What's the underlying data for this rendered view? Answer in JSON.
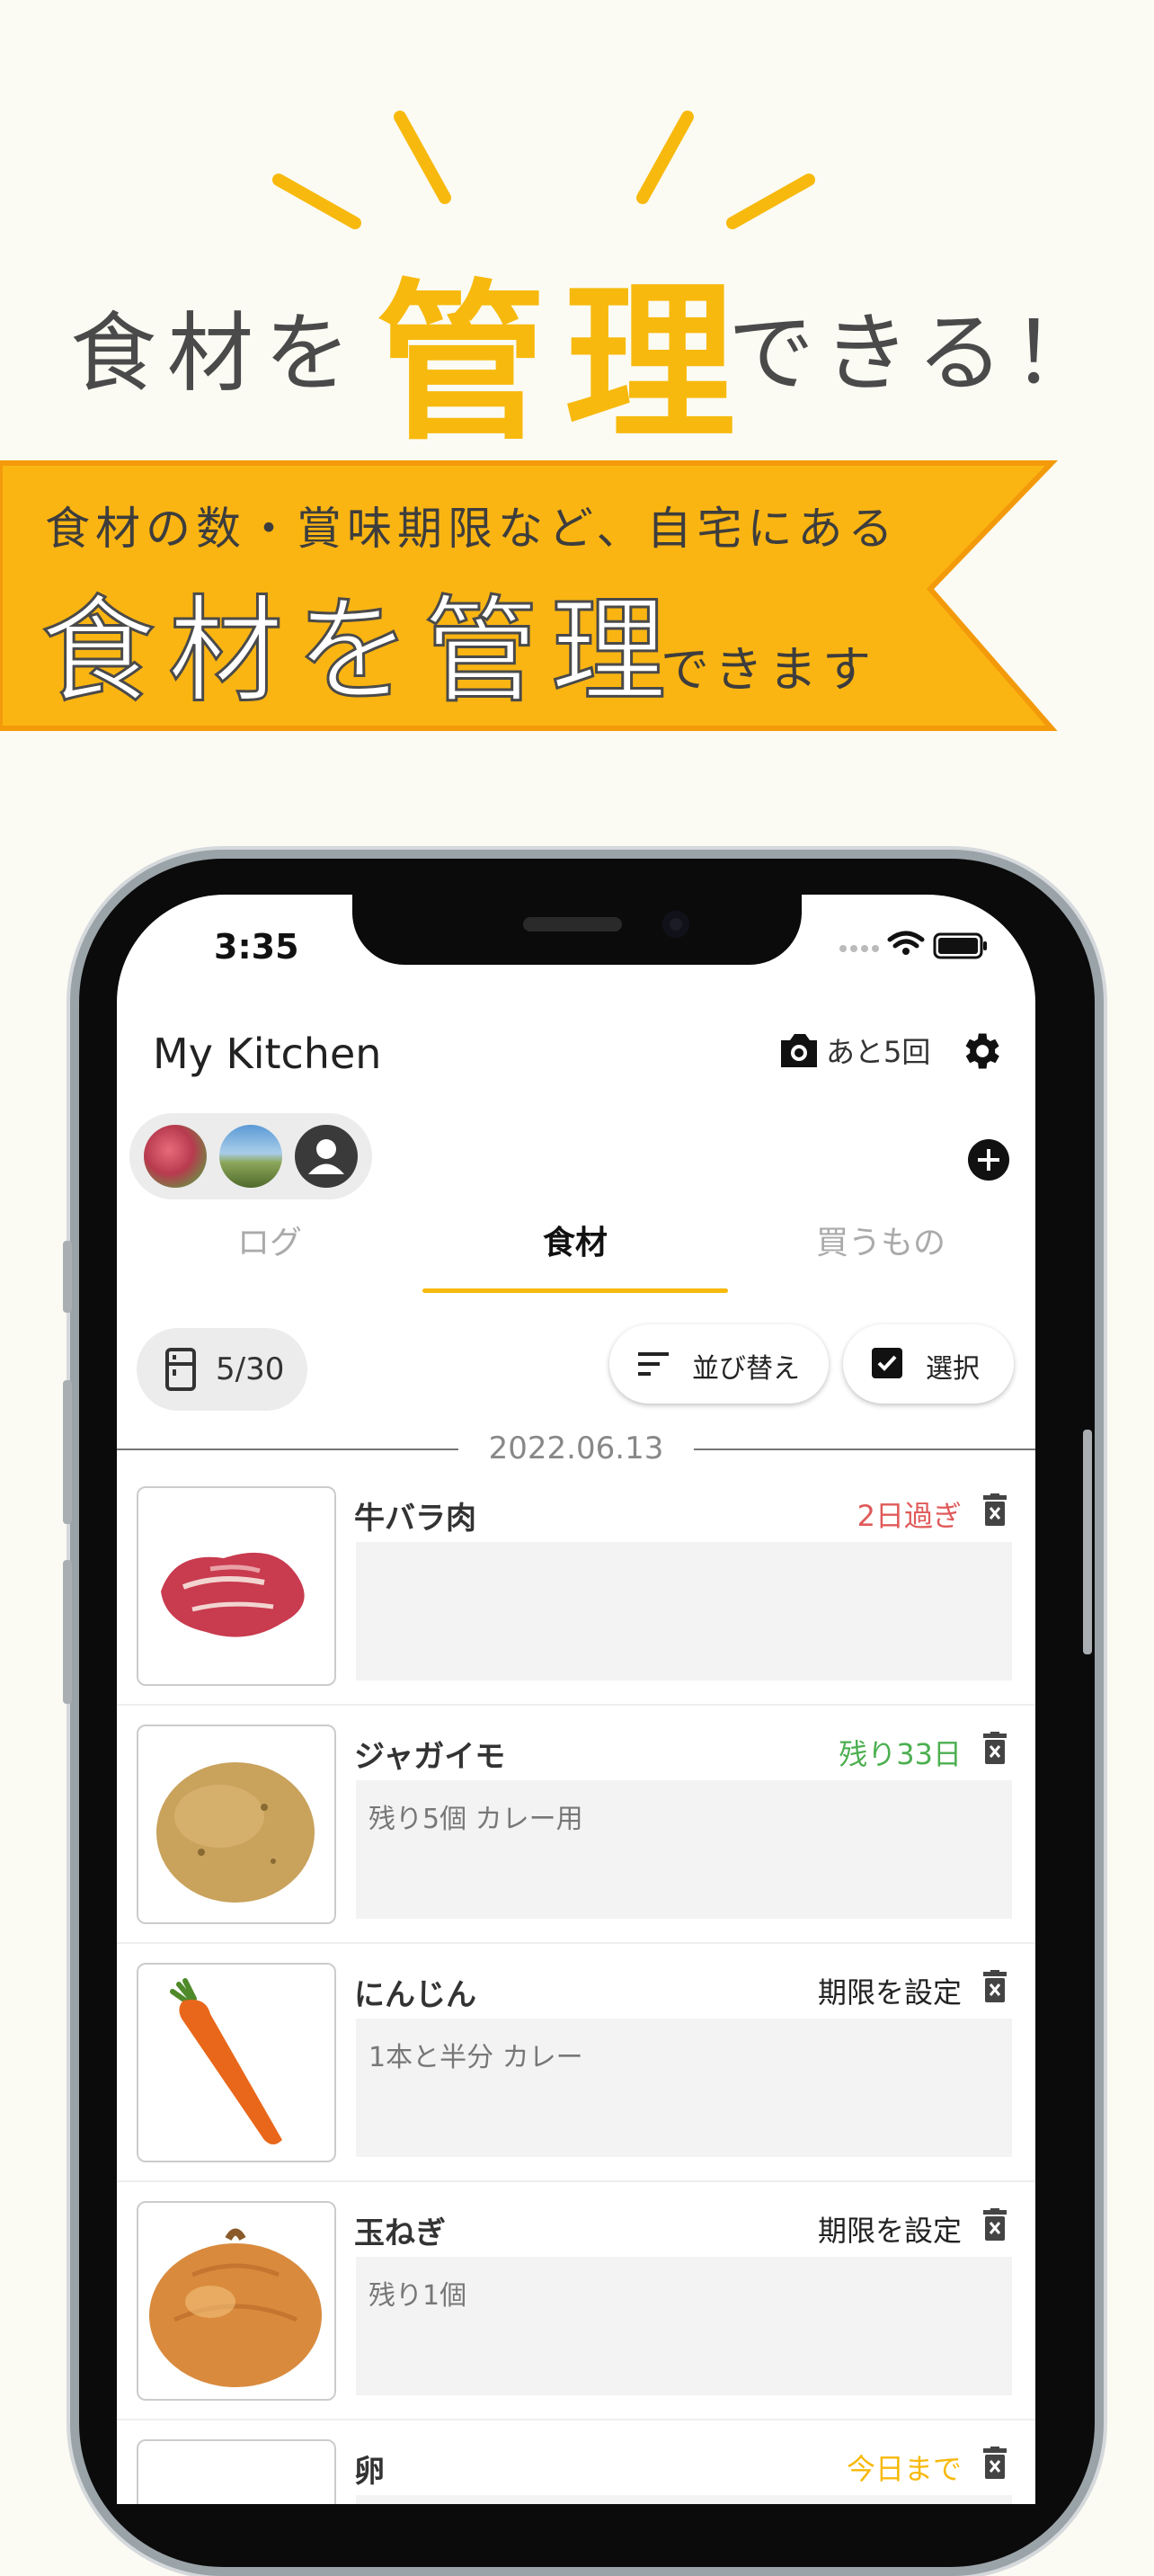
{
  "hero": {
    "title_pre": "食材を",
    "title_big": "管理",
    "title_post": "できる！"
  },
  "ribbon": {
    "subtitle": "食材の数・賞味期限など、自宅にある",
    "main": "食材を管理",
    "tail": "できます"
  },
  "status_bar": {
    "time": "3:35"
  },
  "app": {
    "title": "My Kitchen",
    "camera_remaining": "あと5回",
    "tabs": [
      {
        "label": "ログ",
        "active": false
      },
      {
        "label": "食材",
        "active": true
      },
      {
        "label": "買うもの",
        "active": false
      }
    ],
    "stock_count": "5/30",
    "sort_label": "並び替え",
    "select_label": "選択",
    "date": "2022.06.13",
    "items": [
      {
        "name": "牛バラ肉",
        "expiry": "2日過ぎ",
        "expiry_color": "#e05a5a",
        "memo": "",
        "thumb": "meat-image"
      },
      {
        "name": "ジャガイモ",
        "expiry": "残り33日",
        "expiry_color": "#4caf50",
        "memo": "残り5個 カレー用",
        "thumb": "potato-image"
      },
      {
        "name": "にんじん",
        "expiry": "期限を設定",
        "expiry_color": "#222222",
        "memo": "1本と半分 カレー",
        "thumb": "carrot-image"
      },
      {
        "name": "玉ねぎ",
        "expiry": "期限を設定",
        "expiry_color": "#222222",
        "memo": "残り1個",
        "thumb": "onion-image"
      },
      {
        "name": "卵",
        "expiry": "今日まで",
        "expiry_color": "#f7b90d",
        "memo": "",
        "thumb": "egg-image"
      }
    ]
  },
  "colors": {
    "accent": "#f7b90d",
    "background": "#fbfbf4"
  }
}
